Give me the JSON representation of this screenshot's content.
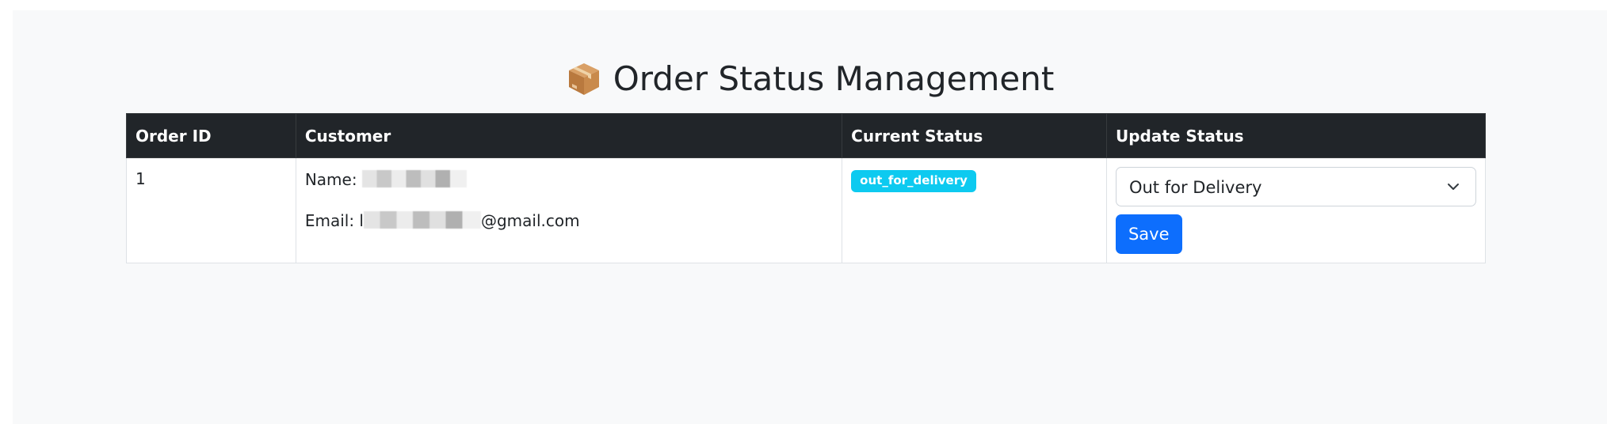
{
  "page": {
    "title": "Order Status Management",
    "title_icon": "package-icon"
  },
  "table": {
    "headers": {
      "order_id": "Order ID",
      "customer": "Customer",
      "current_status": "Current Status",
      "update_status": "Update Status"
    },
    "rows": [
      {
        "order_id": "1",
        "name_label": "Name:",
        "email_label": "Email:",
        "email_prefix": "l",
        "email_suffix": "@gmail.com",
        "status_badge": "out_for_delivery",
        "status_select_value": "Out for Delivery",
        "save_label": "Save"
      }
    ]
  },
  "colors": {
    "header_bg": "#212529",
    "badge_bg": "#0dcaf0",
    "primary": "#0d6efd",
    "page_bg": "#f8f9fa"
  }
}
